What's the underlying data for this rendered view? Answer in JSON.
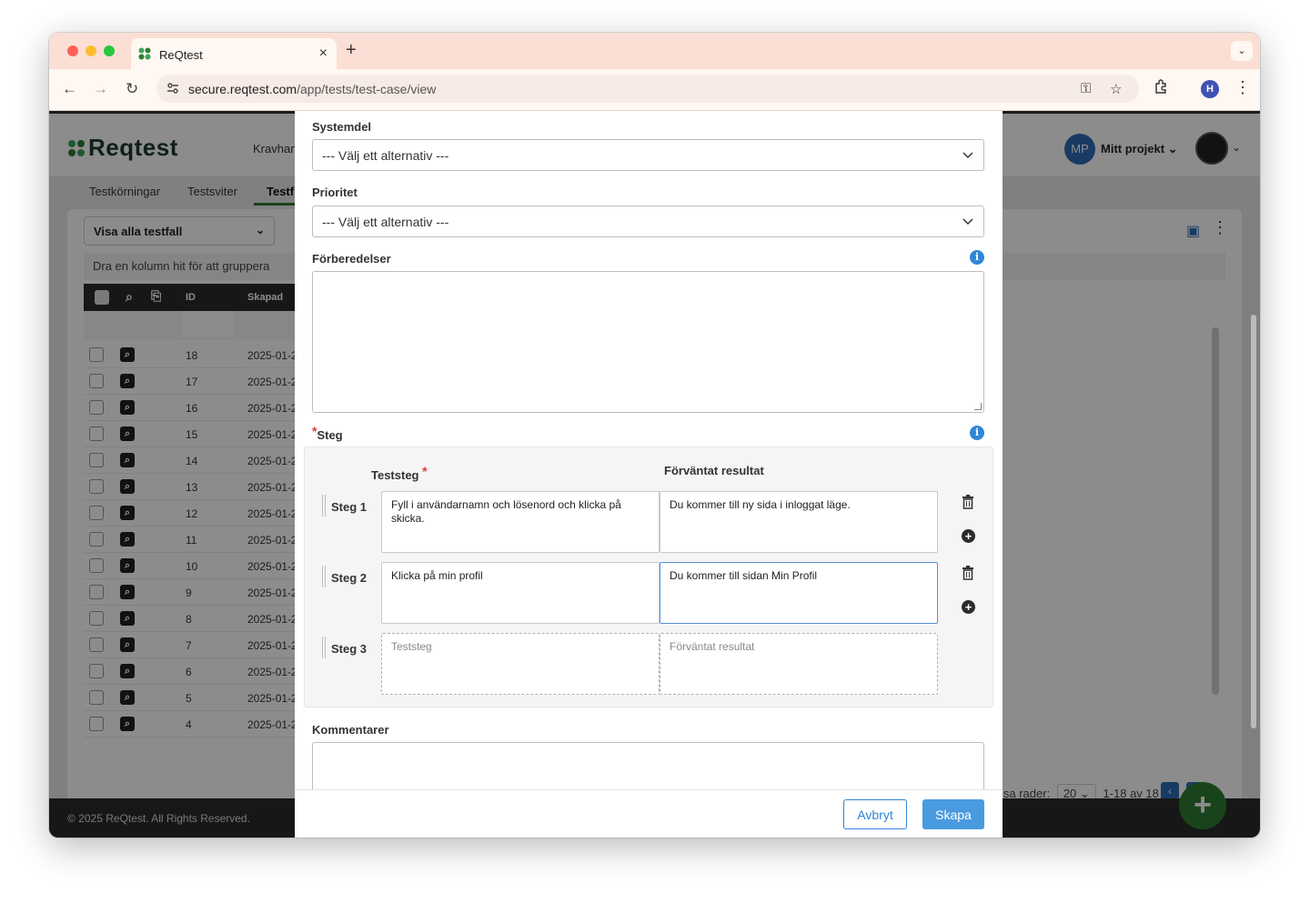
{
  "browser": {
    "tab_title": "ReQtest",
    "tab_close": "×",
    "new_tab": "+",
    "url_host": "secure.reqtest.com",
    "url_path": "/app/tests/test-case/view",
    "profile_initial": "H"
  },
  "app": {
    "logo_text": "Reqtest",
    "nav_partial": "Kravhan",
    "project_initials": "MP",
    "project_name": "Mitt projekt",
    "subtabs": [
      "Testkörningar",
      "Testsviter",
      "Testf"
    ],
    "filter_label": "Visa alla testfall",
    "group_hint": "Dra en kolumn hit för att gruppera",
    "columns": {
      "id": "ID",
      "created": "Skapad"
    },
    "rows": [
      {
        "id": "18",
        "date": "2025-01-2"
      },
      {
        "id": "17",
        "date": "2025-01-2"
      },
      {
        "id": "16",
        "date": "2025-01-2"
      },
      {
        "id": "15",
        "date": "2025-01-2"
      },
      {
        "id": "14",
        "date": "2025-01-2"
      },
      {
        "id": "13",
        "date": "2025-01-2"
      },
      {
        "id": "12",
        "date": "2025-01-2"
      },
      {
        "id": "11",
        "date": "2025-01-2"
      },
      {
        "id": "10",
        "date": "2025-01-2"
      },
      {
        "id": "9",
        "date": "2025-01-2"
      },
      {
        "id": "8",
        "date": "2025-01-2"
      },
      {
        "id": "7",
        "date": "2025-01-2"
      },
      {
        "id": "6",
        "date": "2025-01-2"
      },
      {
        "id": "5",
        "date": "2025-01-2"
      },
      {
        "id": "4",
        "date": "2025-01-2"
      }
    ],
    "pager_label": "isa rader:",
    "pager_size": "20",
    "pager_range": "1-18 av 18",
    "footer": "© 2025 ReQtest. All Rights Reserved.",
    "fab": "+"
  },
  "modal": {
    "systemdel_label": "Systemdel",
    "systemdel_value": "--- Välj ett alternativ ---",
    "prioritet_label": "Prioritet",
    "prioritet_value": "--- Välj ett alternativ ---",
    "forberedelser_label": "Förberedelser",
    "steg_label": "Steg",
    "teststeg_header": "Teststeg",
    "forvantat_header": "Förväntat resultat",
    "steps": [
      {
        "label": "Steg 1",
        "action": "Fyll i användarnamn och lösenord och klicka på skicka.",
        "expected": "Du kommer till ny sida i inloggat läge."
      },
      {
        "label": "Steg 2",
        "action": "Klicka på min profil",
        "expected": "Du kommer till sidan Min Profil"
      },
      {
        "label": "Steg 3",
        "action_placeholder": "Teststeg",
        "expected_placeholder": "Förväntat resultat"
      }
    ],
    "kommentarer_label": "Kommentarer",
    "cancel": "Avbryt",
    "create": "Skapa"
  },
  "colors": {
    "accent": "#2f86d8",
    "brand": "#2e7d32",
    "required": "#e53935"
  }
}
